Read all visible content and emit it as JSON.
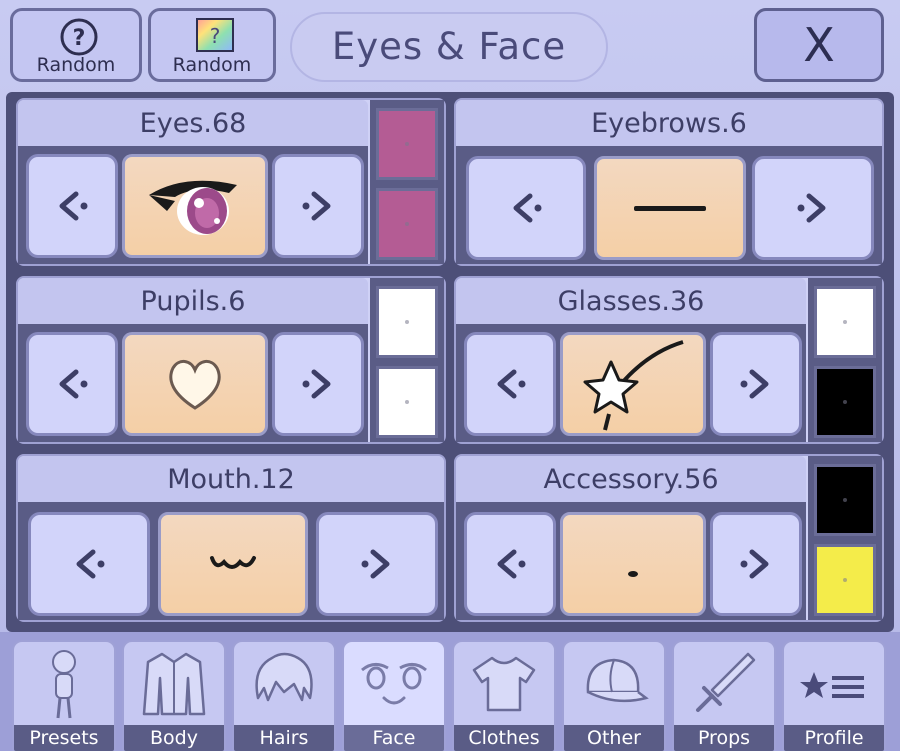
{
  "header": {
    "random_buttons": [
      {
        "label": "Random",
        "icon": "question-mark-icon"
      },
      {
        "label": "Random",
        "icon": "rainbow-question-icon"
      }
    ],
    "title": "Eyes & Face",
    "close_label": "X"
  },
  "panels": [
    {
      "name": "eyes",
      "title": "Eyes.68",
      "swatches": [
        "#b45c94",
        "#b45c94"
      ],
      "preview_icon": "eye-icon"
    },
    {
      "name": "eyebrows",
      "title": "Eyebrows.6",
      "swatches": [],
      "preview_icon": "eyebrow-line-icon"
    },
    {
      "name": "pupils",
      "title": "Pupils.6",
      "swatches": [
        "#ffffff",
        "#ffffff"
      ],
      "preview_icon": "heart-pupil-icon"
    },
    {
      "name": "glasses",
      "title": "Glasses.36",
      "swatches": [
        "#ffffff",
        "#000000"
      ],
      "preview_icon": "star-glasses-icon"
    },
    {
      "name": "mouth",
      "title": "Mouth.12",
      "swatches": [],
      "preview_icon": "cat-mouth-icon"
    },
    {
      "name": "accessory",
      "title": "Accessory.56",
      "swatches": [
        "#000000",
        "#f4ec4a"
      ],
      "preview_icon": "dot-accessory-icon"
    }
  ],
  "tabs": [
    {
      "label": "Presets",
      "icon": "person-icon",
      "active": false
    },
    {
      "label": "Body",
      "icon": "jacket-icon",
      "active": false
    },
    {
      "label": "Hairs",
      "icon": "hair-icon",
      "active": false
    },
    {
      "label": "Face",
      "icon": "face-icon",
      "active": true
    },
    {
      "label": "Clothes",
      "icon": "shirt-icon",
      "active": false
    },
    {
      "label": "Other",
      "icon": "cap-icon",
      "active": false
    },
    {
      "label": "Props",
      "icon": "sword-icon",
      "active": false
    },
    {
      "label": "Profile",
      "icon": "star-list-icon",
      "active": false
    }
  ]
}
